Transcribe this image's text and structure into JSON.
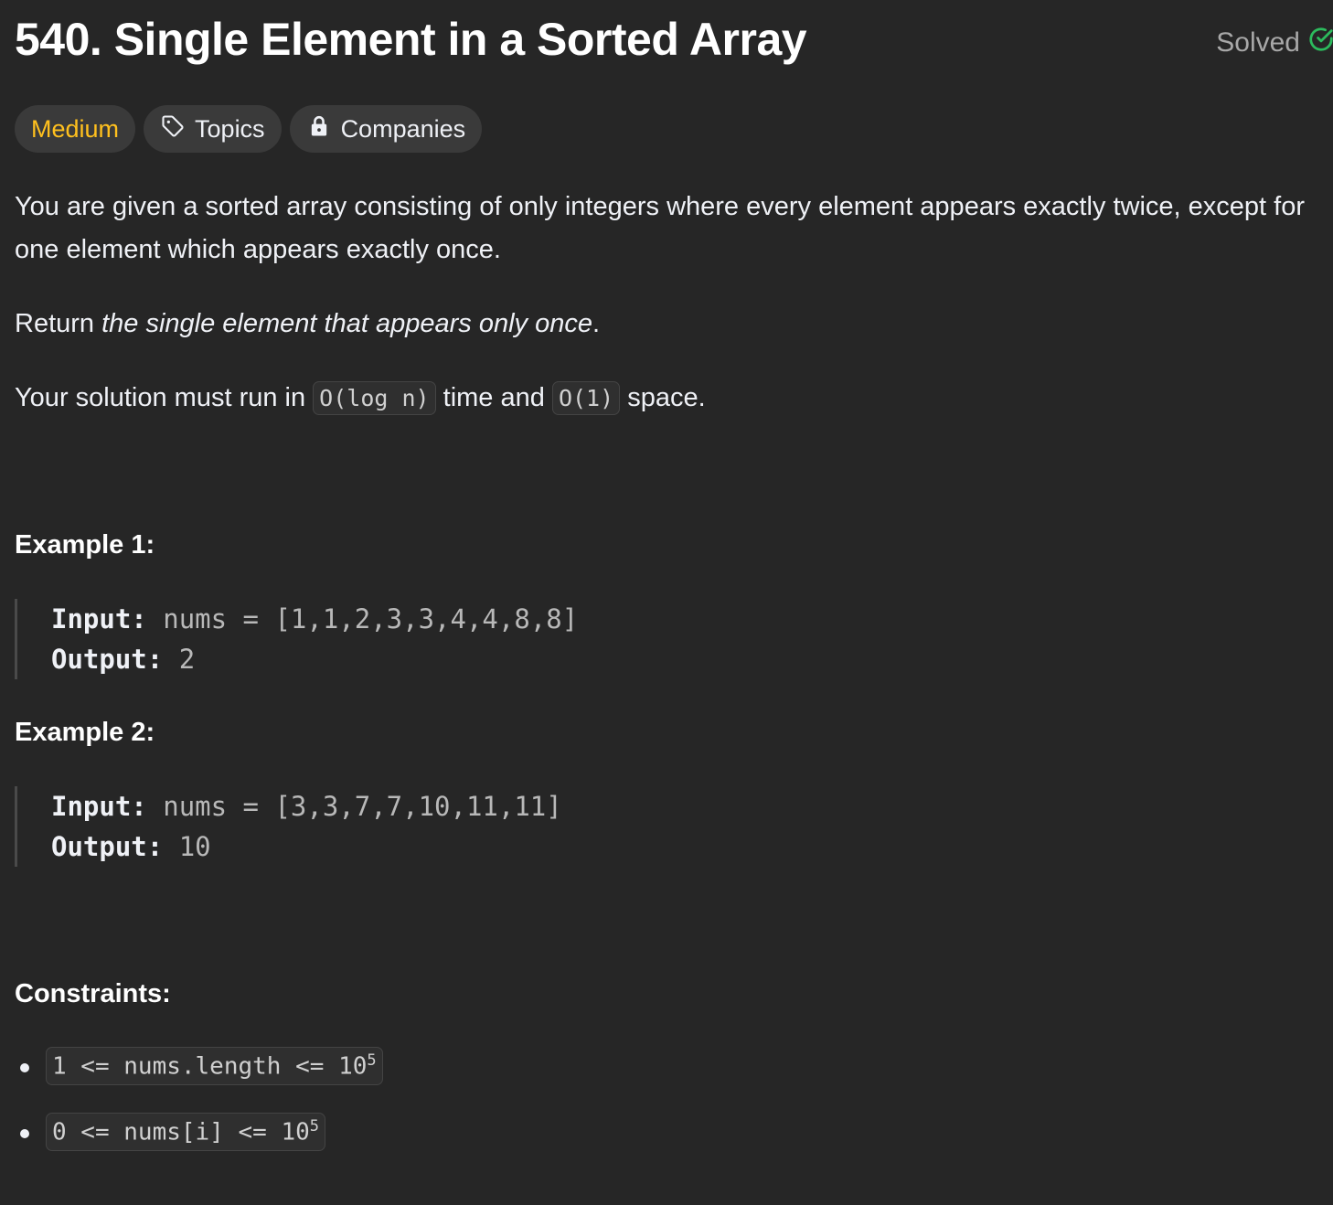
{
  "problem": {
    "title": "540. Single Element in a Sorted Array",
    "status": "Solved",
    "status_color": "#2cbb5d"
  },
  "chips": {
    "difficulty": "Medium",
    "topics": "Topics",
    "companies": "Companies"
  },
  "description": {
    "p1": "You are given a sorted array consisting of only integers where every element appears exactly twice, except for one element which appears exactly once.",
    "p2_prefix": "Return ",
    "p2_em": "the single element that appears only once",
    "p2_suffix": ".",
    "p3_prefix": "Your solution must run in ",
    "p3_time": "O(log n)",
    "p3_mid": " time and ",
    "p3_space": "O(1)",
    "p3_suffix": " space."
  },
  "examples": [
    {
      "heading": "Example 1:",
      "input_label": "Input:",
      "input_value": "nums = [1,1,2,3,3,4,4,8,8]",
      "output_label": "Output:",
      "output_value": "2"
    },
    {
      "heading": "Example 2:",
      "input_label": "Input:",
      "input_value": "nums = [3,3,7,7,10,11,11]",
      "output_label": "Output:",
      "output_value": "10"
    }
  ],
  "constraints": {
    "heading": "Constraints:",
    "items": [
      {
        "text": "1 <= nums.length <= 10",
        "exp": "5"
      },
      {
        "text": "0 <= nums[i] <= 10",
        "exp": "5"
      }
    ]
  }
}
